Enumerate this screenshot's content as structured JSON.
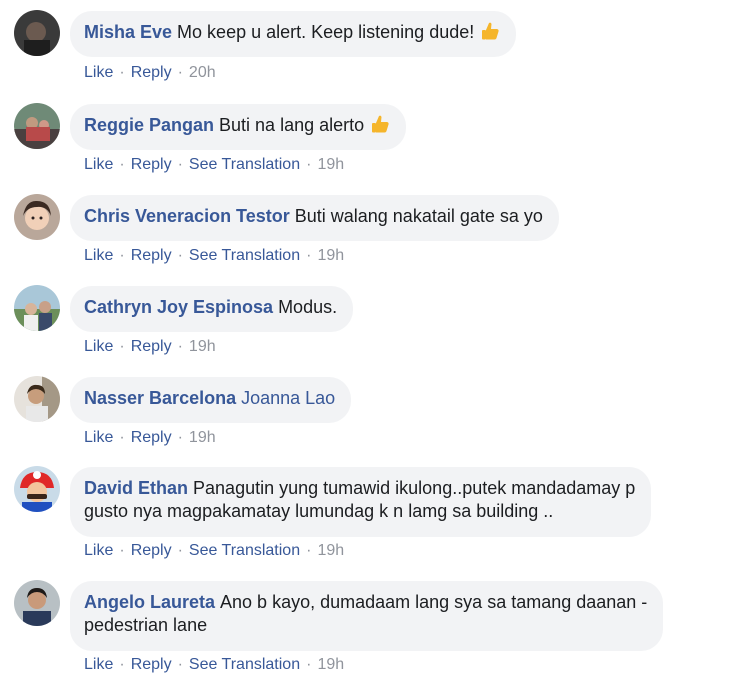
{
  "colors": {
    "link": "#385898",
    "bubble": "#f2f3f5",
    "meta": "#90949c",
    "thumb": "#f5b52b"
  },
  "actions": {
    "like": "Like",
    "reply": "Reply",
    "translate": "See Translation",
    "separator": "·"
  },
  "comments": [
    {
      "author": "Misha Eve",
      "text": "Mo keep u alert. Keep listening dude!",
      "emoji": "thumbs-up-icon",
      "time": "20h"
    },
    {
      "author": "Reggie Pangan",
      "text": "Buti na lang alerto",
      "emoji": "thumbs-up-icon",
      "time": "19h"
    },
    {
      "author": "Chris Veneracion Testor",
      "text": "Buti walang nakatail gate sa yo",
      "time": "19h"
    },
    {
      "author": "Cathryn Joy Espinosa",
      "text": "Modus.",
      "time": "19h"
    },
    {
      "author": "Nasser Barcelona",
      "mention": "Joanna Lao",
      "time": "19h"
    },
    {
      "author": "David Ethan",
      "text": "Panagutin yung tumawid ikulong..putek mandadamay p",
      "text2": "gusto nya magpakamatay lumundag k n lamg sa building ..",
      "time": "19h"
    },
    {
      "author": "Angelo Laureta",
      "text": "Ano b kayo, dumadaam lang sya sa tamang daanan -",
      "text2": "pedestrian lane",
      "time": "19h"
    }
  ]
}
